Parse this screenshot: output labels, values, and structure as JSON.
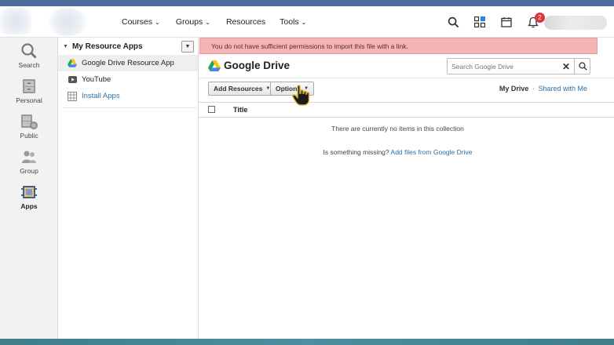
{
  "topnav": {
    "links": [
      {
        "label": "Courses",
        "has_menu": true
      },
      {
        "label": "Groups",
        "has_menu": true
      },
      {
        "label": "Resources",
        "has_menu": false
      },
      {
        "label": "Tools",
        "has_menu": true
      }
    ],
    "notifications_count": "2",
    "icons": [
      "search-icon",
      "apps-grid-icon",
      "calendar-icon",
      "bell-icon"
    ]
  },
  "rail": {
    "items": [
      {
        "label": "Search",
        "icon": "search-icon"
      },
      {
        "label": "Personal",
        "icon": "personal-drawer-icon"
      },
      {
        "label": "Public",
        "icon": "public-icon"
      },
      {
        "label": "Group",
        "icon": "group-icon"
      },
      {
        "label": "Apps",
        "icon": "apps-icon",
        "active": true
      }
    ]
  },
  "panel": {
    "heading": "My Resource Apps",
    "items": [
      {
        "label": "Google Drive Resource App",
        "icon": "google-drive-icon",
        "selected": true
      },
      {
        "label": "YouTube",
        "icon": "youtube-icon"
      },
      {
        "label": "Install Apps",
        "icon": "install-apps-icon",
        "link": true
      }
    ]
  },
  "main": {
    "alert": "You do not have sufficient permissions to import this file with a link.",
    "title": "Google Drive",
    "search": {
      "placeholder": "Search Google Drive",
      "value": ""
    },
    "toolbar": {
      "add_resources": "Add Resources",
      "options": "Options"
    },
    "view": {
      "current": "My Drive",
      "separator": "·",
      "alternate": "Shared with Me"
    },
    "table": {
      "column_title": "Title"
    },
    "empty_message": "There are currently no items in this collection",
    "missing_prefix": "Is something missing?",
    "missing_link": "Add files from Google Drive"
  },
  "colors": {
    "top_stripe": "#4d6e9c",
    "alert_bg": "#f3b4b6",
    "link": "#2d6fa8",
    "badge": "#d9363e"
  }
}
